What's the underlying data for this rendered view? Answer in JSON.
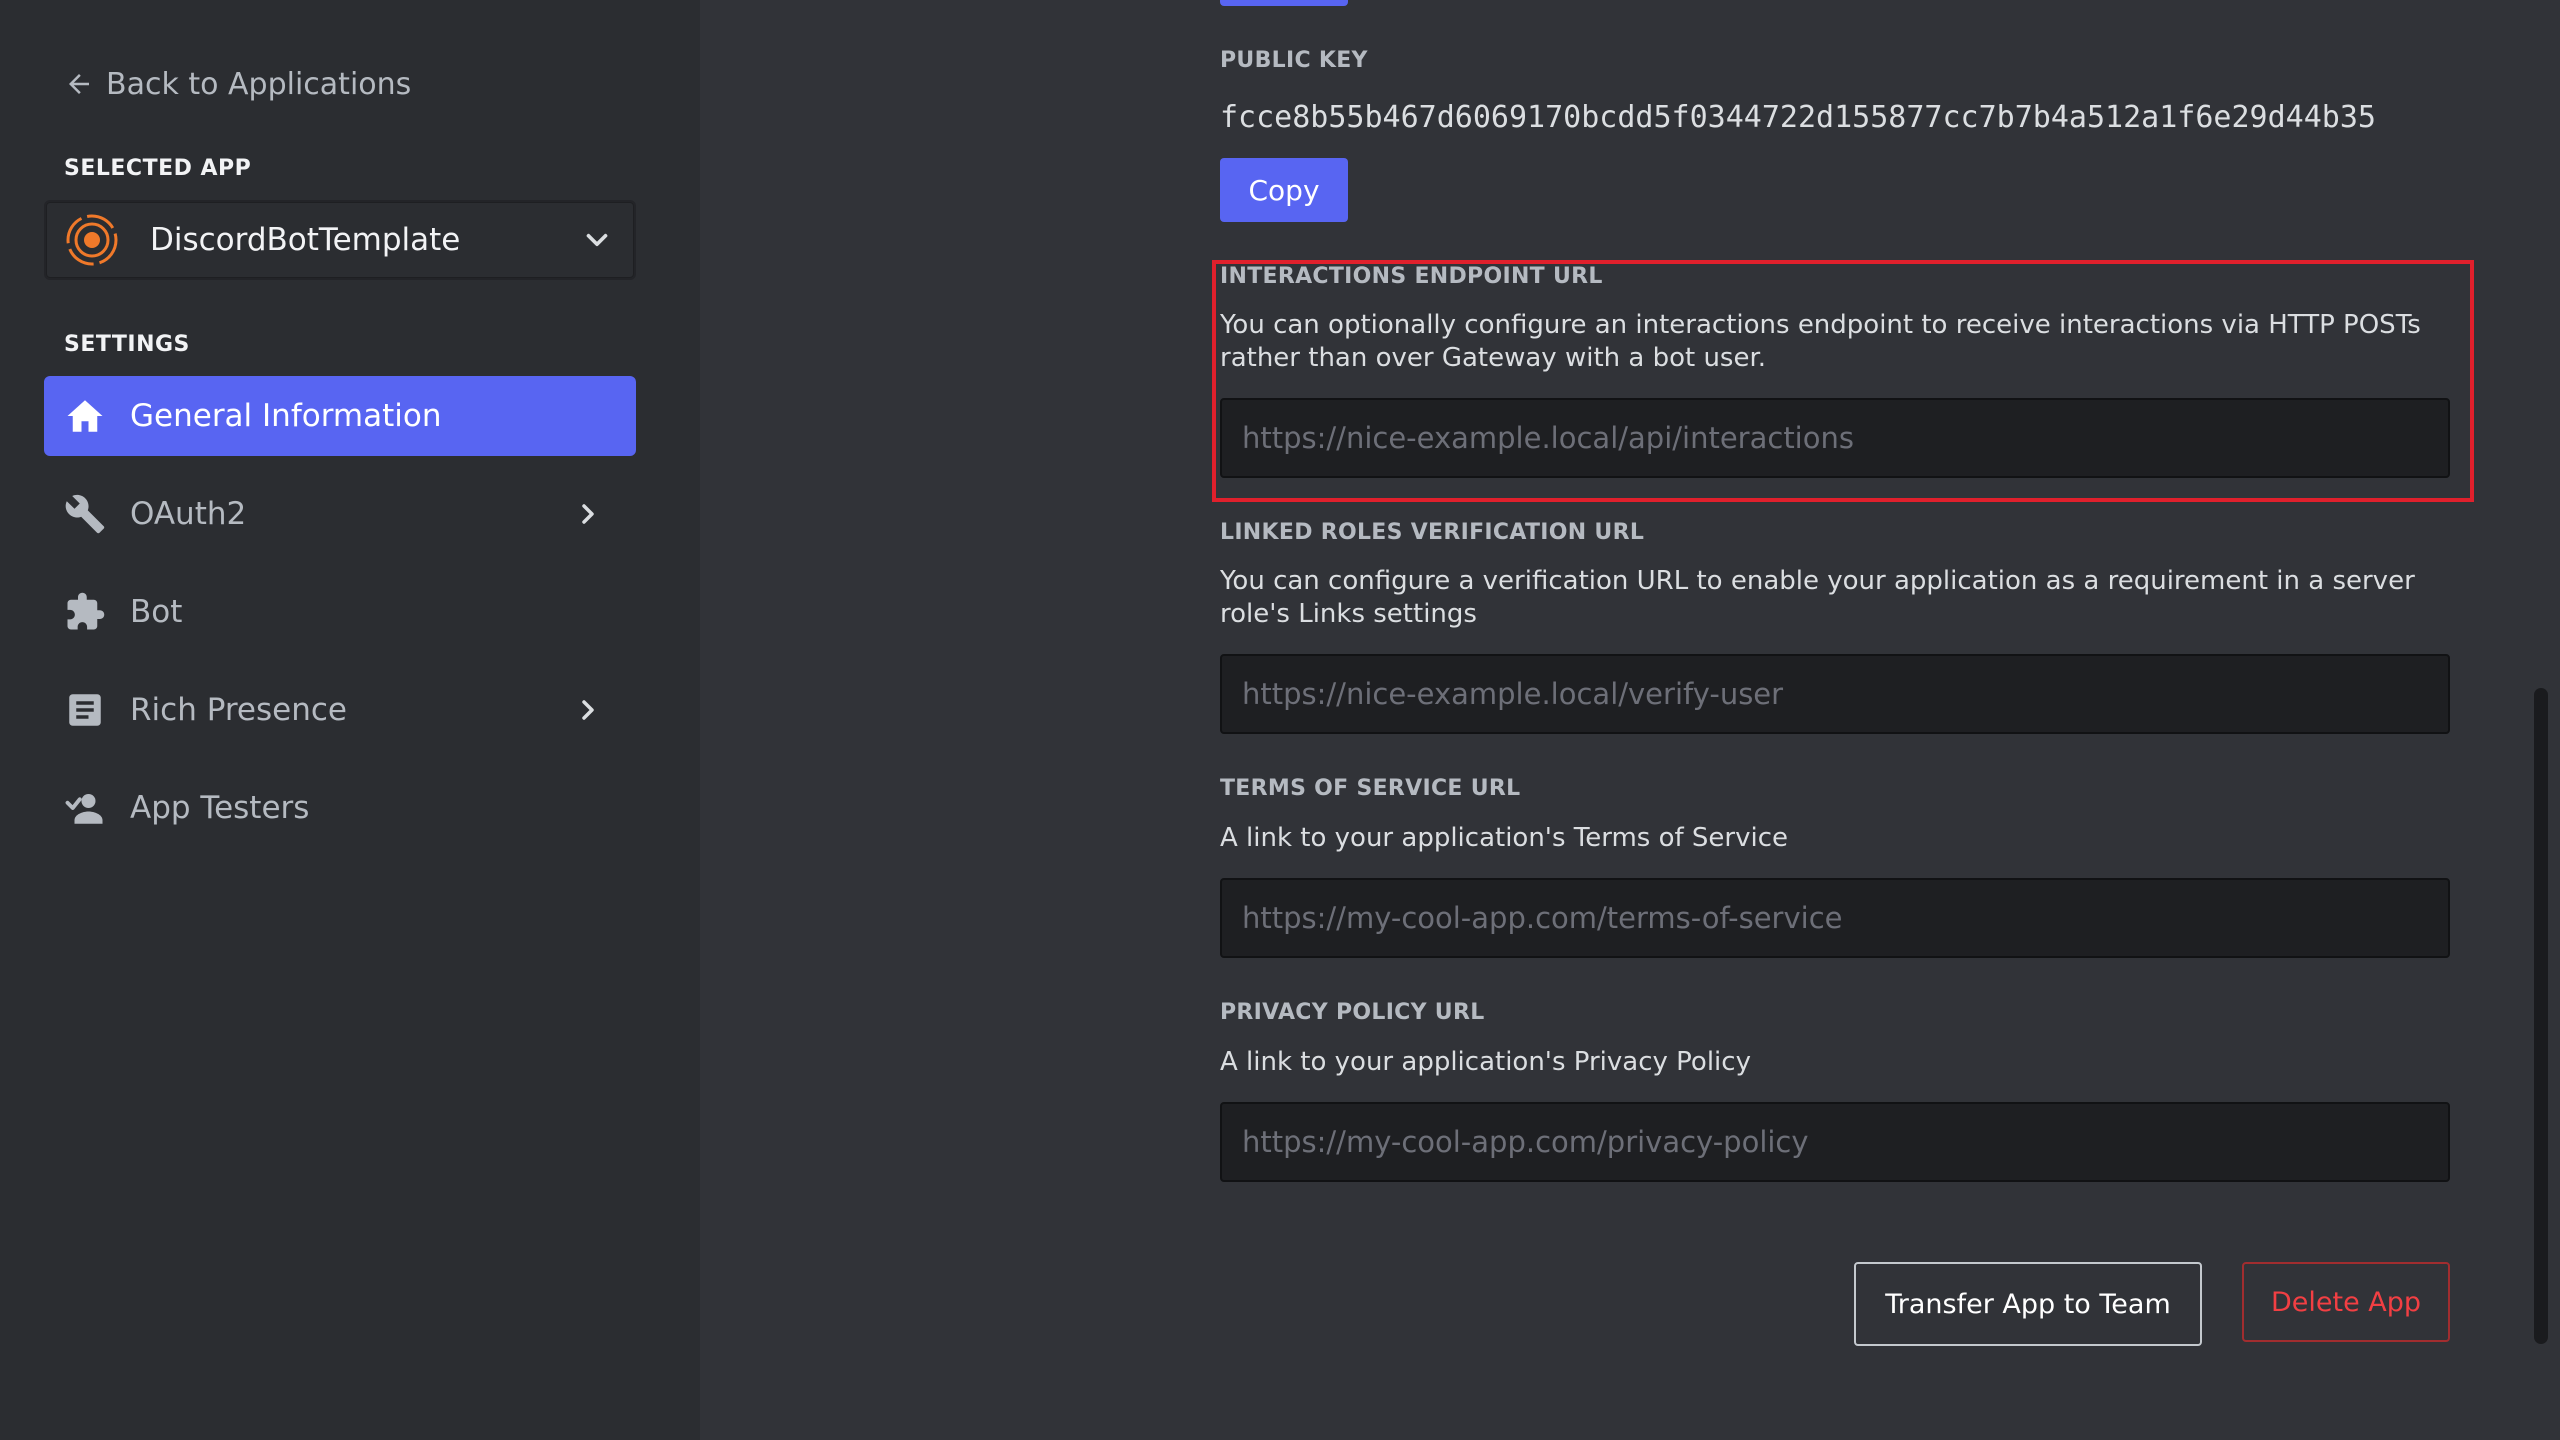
{
  "sidebar": {
    "back_label": "Back to Applications",
    "selected_app_title": "SELECTED APP",
    "selected_app_name": "DiscordBotTemplate",
    "settings_title": "SETTINGS",
    "items": [
      {
        "label": "General Information",
        "icon": "home-icon",
        "active": true,
        "has_arrow": false
      },
      {
        "label": "OAuth2",
        "icon": "wrench-icon",
        "active": false,
        "has_arrow": true
      },
      {
        "label": "Bot",
        "icon": "puzzle-icon",
        "active": false,
        "has_arrow": false
      },
      {
        "label": "Rich Presence",
        "icon": "document-icon",
        "active": false,
        "has_arrow": true
      },
      {
        "label": "App Testers",
        "icon": "person-icon",
        "active": false,
        "has_arrow": false
      }
    ]
  },
  "main": {
    "public_key": {
      "title": "PUBLIC KEY",
      "value": "fcce8b55b467d6069170bcdd5f0344722d155877cc7b7b4a512a1f6e29d44b35",
      "copy_label": "Copy"
    },
    "interactions": {
      "title": "INTERACTIONS ENDPOINT URL",
      "description": "You can optionally configure an interactions endpoint to receive interactions via HTTP POSTs rather than over Gateway with a bot user.",
      "placeholder": "https://nice-example.local/api/interactions"
    },
    "linked_roles": {
      "title": "LINKED ROLES VERIFICATION URL",
      "description": "You can configure a verification URL to enable your application as a requirement in a server role's Links settings",
      "placeholder": "https://nice-example.local/verify-user"
    },
    "terms": {
      "title": "TERMS OF SERVICE URL",
      "description": "A link to your application's Terms of Service",
      "placeholder": "https://my-cool-app.com/terms-of-service"
    },
    "privacy": {
      "title": "PRIVACY POLICY URL",
      "description": "A link to your application's Privacy Policy",
      "placeholder": "https://my-cool-app.com/privacy-policy"
    },
    "transfer_label": "Transfer App to Team",
    "delete_label": "Delete App"
  },
  "colors": {
    "accent": "#5865f2",
    "highlight": "#e0202c",
    "danger": "#f23f43"
  }
}
